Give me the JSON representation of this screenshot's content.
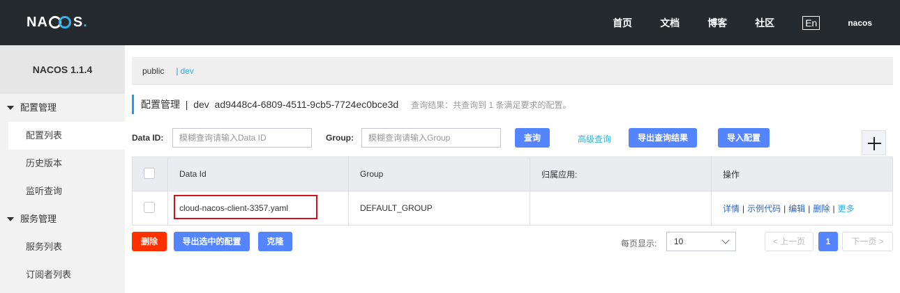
{
  "header": {
    "logo_text": "NACOS.",
    "nav": [
      "首页",
      "文档",
      "博客",
      "社区"
    ],
    "lang": "En",
    "user": "nacos"
  },
  "sidebar": {
    "version": "NACOS 1.1.4",
    "groups": [
      {
        "title": "配置管理",
        "items": [
          "配置列表",
          "历史版本",
          "监听查询"
        ]
      },
      {
        "title": "服务管理",
        "items": [
          "服务列表",
          "订阅者列表"
        ]
      }
    ]
  },
  "namespaces": {
    "public": "public",
    "sep": "|",
    "active": "dev"
  },
  "title": {
    "text": "配置管理  |  dev  ad9448c4-6809-4511-9cb5-7724ec0bce3d",
    "result": "查询结果：共查询到 1 条满足要求的配置。"
  },
  "filter": {
    "dataid_label": "Data ID:",
    "dataid_placeholder": "模糊查询请输入Data ID",
    "group_label": "Group:",
    "group_placeholder": "模糊查询请输入Group",
    "search": "查询",
    "advanced": "高级查询",
    "export_result": "导出查询结果",
    "import": "导入配置"
  },
  "table": {
    "headers": [
      "Data Id",
      "Group",
      "归属应用:",
      "操作"
    ],
    "rows": [
      {
        "data_id": "cloud-nacos-client-3357.yaml",
        "group": "DEFAULT_GROUP",
        "app": "",
        "ops": [
          "详情",
          "示例代码",
          "编辑",
          "删除",
          "更多"
        ]
      }
    ]
  },
  "bottom": {
    "delete": "删除",
    "export_selected": "导出选中的配置",
    "clone": "克隆",
    "page_size_label": "每页显示:",
    "page_size": "10",
    "prev": "上一页",
    "page": "1",
    "next": "下一页"
  }
}
